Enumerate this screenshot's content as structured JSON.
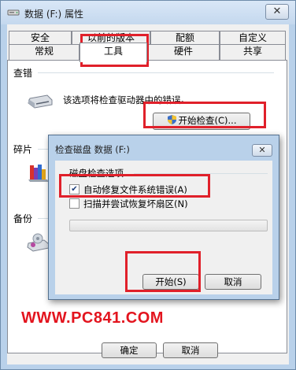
{
  "window": {
    "title": "数据 (F:) 属性",
    "close_glyph": "✕"
  },
  "tabs_row1": [
    {
      "label": "安全"
    },
    {
      "label": "以前的版本"
    },
    {
      "label": "配额"
    },
    {
      "label": "自定义"
    }
  ],
  "tabs_row2": [
    {
      "label": "常规"
    },
    {
      "label": "工具"
    },
    {
      "label": "硬件"
    },
    {
      "label": "共享"
    }
  ],
  "active_tab": "工具",
  "check_section": {
    "label": "查错",
    "description": "该选项将检查驱动器中的错误。",
    "button_label": "开始检查(C)..."
  },
  "defrag_section": {
    "label": "碎片"
  },
  "backup_section": {
    "label": "备份"
  },
  "dialog": {
    "title": "检查磁盘 数据 (F:)",
    "close_glyph": "✕",
    "options_label": "磁盘检查选项",
    "options": [
      {
        "label": "自动修复文件系统错误(A)",
        "checked": true
      },
      {
        "label": "扫描并尝试恢复坏扇区(N)",
        "checked": false
      }
    ],
    "progress": 0,
    "start_label": "开始(S)",
    "cancel_label": "取消"
  },
  "footer": {
    "ok_label": "确定",
    "cancel_label": "取消"
  },
  "watermark": "WWW.PC841.COM",
  "colors": {
    "highlight_box": "#e0202a",
    "window_frame": "#b9d1ea"
  }
}
